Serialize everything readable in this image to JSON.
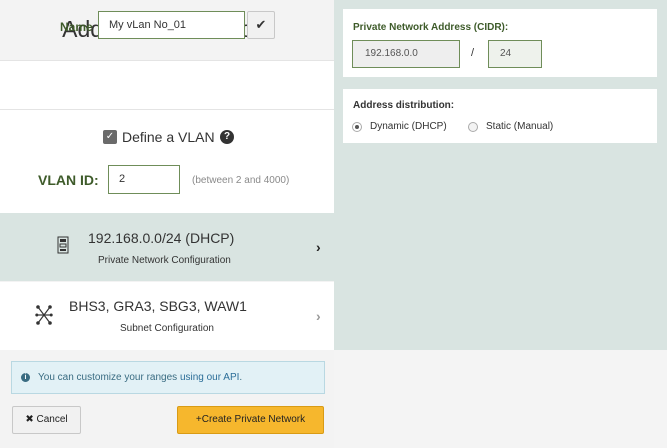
{
  "title": "Add Private Network",
  "name_field": {
    "label": "Name",
    "value": "My vLan No_01",
    "confirm_icon": "check-icon"
  },
  "vlan": {
    "checkbox_label": "Define a VLAN",
    "checked": true,
    "help_icon": "?",
    "id_label": "VLAN ID:",
    "id_value": "2",
    "range_hint": "(between 2 and 4000)"
  },
  "network_config": {
    "main": "192.168.0.0/24 (DHCP)",
    "sub": "Private Network Configuration",
    "icon": "network-port-icon"
  },
  "subnet_config": {
    "main": "BHS3, GRA3, SBG3, WAW1",
    "sub": "Subnet Configuration",
    "icon": "nodes-icon"
  },
  "info": {
    "text": "You can customize your ranges ",
    "link": "using our API",
    "suffix": "."
  },
  "buttons": {
    "cancel": "Cancel",
    "create": "Create Private Network"
  },
  "cidr": {
    "label": "Private Network Address (CIDR):",
    "address": "192.168.0.0",
    "slash": "/",
    "mask": "24"
  },
  "distribution": {
    "label": "Address distribution:",
    "options": [
      "Dynamic (DHCP)",
      "Static (Manual)"
    ],
    "selected": "Dynamic (DHCP)"
  },
  "colors": {
    "accent_green": "#3e5b2a",
    "active_panel": "#d9e4e1",
    "primary_button": "#f6b72d",
    "info_bg": "#e2f1f6"
  }
}
